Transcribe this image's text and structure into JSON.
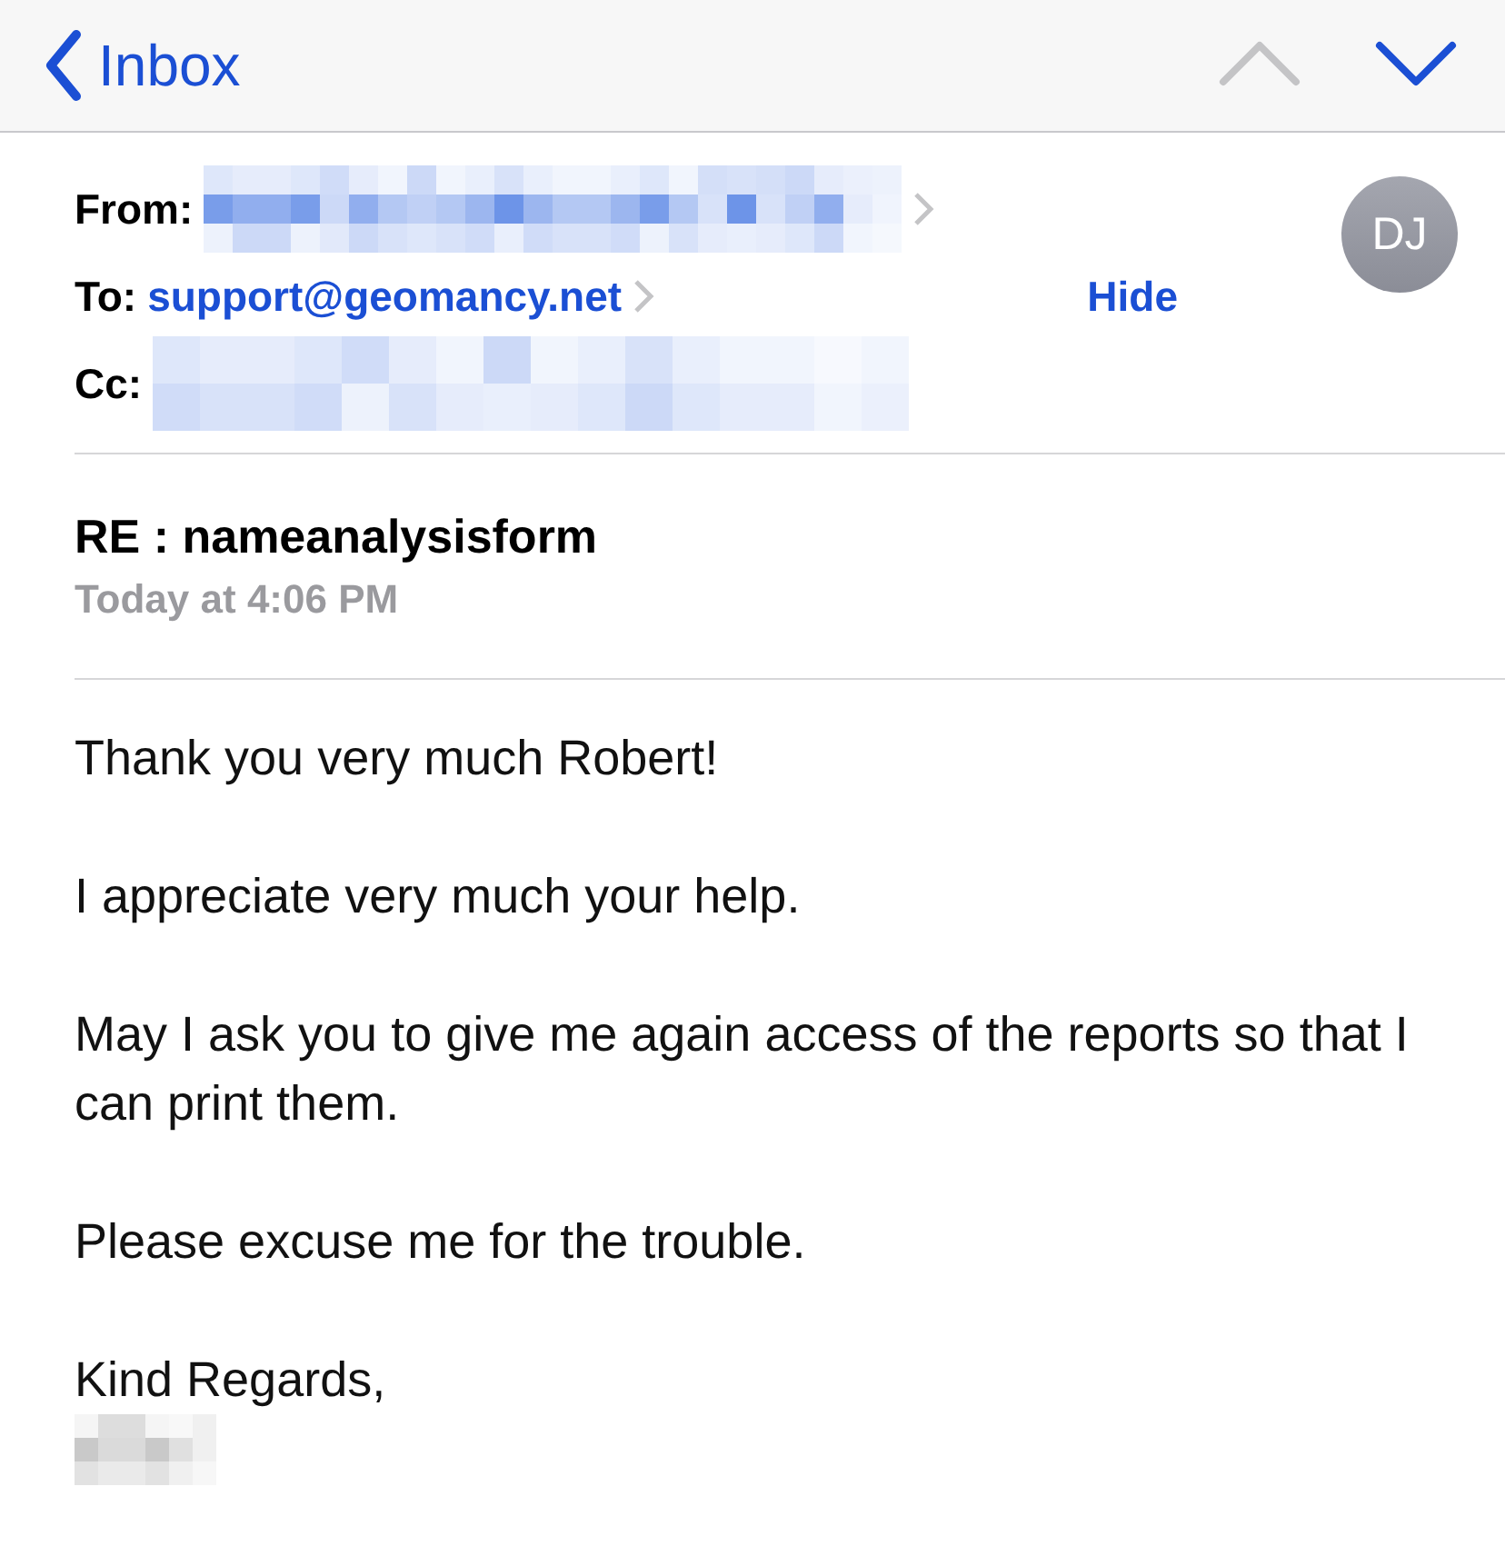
{
  "nav": {
    "back_label": "Inbox",
    "previous_disabled": true,
    "next_disabled": false
  },
  "header": {
    "from_label": "From:",
    "to_label": "To:",
    "to_address": "support@geomancy.net",
    "cc_label": "Cc:",
    "avatar_initials": "DJ",
    "hide_label": "Hide"
  },
  "subject": "RE : nameanalysisform",
  "date": "Today at 4:06 PM",
  "body": [
    "Thank you very much Robert!",
    "I appreciate very much your help.",
    "May I ask you to give me again access of the reports so that I can print them.",
    "Please excuse me for the trouble.",
    "Kind Regards,"
  ]
}
